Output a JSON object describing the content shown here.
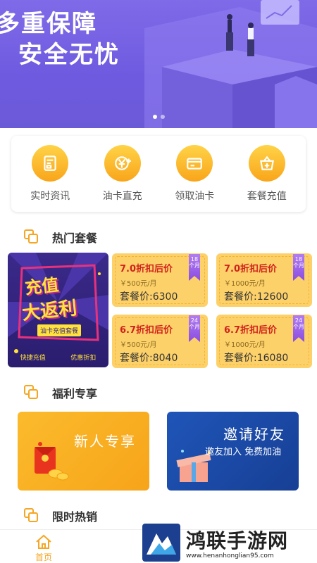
{
  "banner": {
    "line1": "多重保障",
    "line2": "安全无忧",
    "page_count": 2,
    "active_page": 1
  },
  "quick_menu": [
    {
      "label": "实时资讯",
      "icon": "news-icon"
    },
    {
      "label": "油卡直充",
      "icon": "yen-recharge-icon"
    },
    {
      "label": "领取油卡",
      "icon": "card-icon"
    },
    {
      "label": "套餐充值",
      "icon": "basket-icon"
    }
  ],
  "sections": {
    "hot": "热门套餐",
    "welfare": "福利专享",
    "limited": "限时热销"
  },
  "promo": {
    "title1": "充值",
    "title2": "大返利",
    "subtitle": "油卡充值套餐",
    "foot_left": "快捷充值",
    "foot_right": "优惠折扣"
  },
  "packages": [
    {
      "discount": "7.0折扣后价",
      "unit": "￥500元/月",
      "price": "套餐价:6300",
      "tag": "18个月"
    },
    {
      "discount": "7.0折扣后价",
      "unit": "￥1000元/月",
      "price": "套餐价:12600",
      "tag": "18个月"
    },
    {
      "discount": "6.7折扣后价",
      "unit": "￥500元/月",
      "price": "套餐价:8040",
      "tag": "24个月"
    },
    {
      "discount": "6.7折扣后价",
      "unit": "￥1000元/月",
      "price": "套餐价:16080",
      "tag": "24个月"
    }
  ],
  "welfare": {
    "newcomer": "新人专享",
    "invite": "邀请好友",
    "invite_sub": "邀友加入 免费加油"
  },
  "tabbar": {
    "home": "首页"
  },
  "watermark": {
    "name": "鸿联手游网",
    "url": "www.henanhonglian95.com"
  },
  "colors": {
    "accent": "#f5a623",
    "banner": "#7563e2",
    "card": "#fdd16a",
    "discount": "#d0221c"
  }
}
